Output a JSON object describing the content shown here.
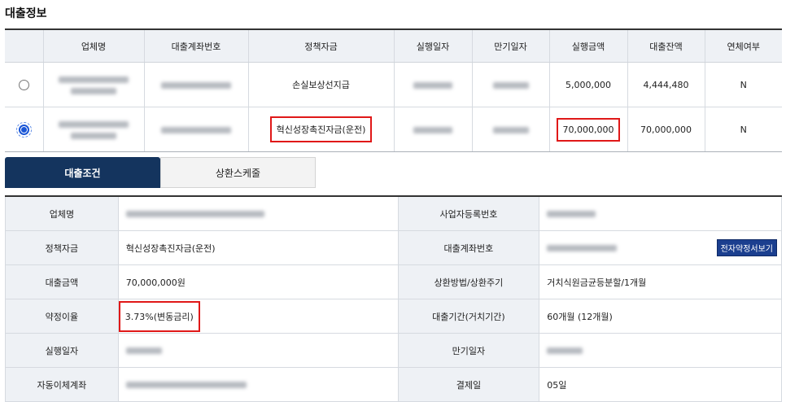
{
  "title": "대출정보",
  "loan_table": {
    "headers": [
      "업체명",
      "대출계좌번호",
      "정책자금",
      "실행일자",
      "만기일자",
      "실행금액",
      "대출잔액",
      "연체여부"
    ],
    "rows": [
      {
        "selected": false,
        "policy_fund": "손실보상선지급",
        "exec_amount": "5,000,000",
        "balance": "4,444,480",
        "overdue": "N"
      },
      {
        "selected": true,
        "policy_fund": "혁신성장촉진자금(운전)",
        "exec_amount": "70,000,000",
        "balance": "70,000,000",
        "overdue": "N"
      }
    ]
  },
  "tabs": {
    "active": "대출조건",
    "inactive": "상환스케줄"
  },
  "detail": {
    "company_label": "업체명",
    "biz_no_label": "사업자등록번호",
    "policy_label": "정책자금",
    "policy_value": "혁신성장촉진자금(운전)",
    "account_label": "대출계좌번호",
    "doc_button": "전자약정서보기",
    "amount_label": "대출금액",
    "amount_value": "70,000,000원",
    "repay_label": "상환방법/상환주기",
    "repay_value": "거치식원금균등분할/1개월",
    "rate_label": "약정이율",
    "rate_value": "3.73%(변동금리)",
    "period_label": "대출기간(거치기간)",
    "period_value": "60개월 (12개월)",
    "exec_date_label": "실행일자",
    "maturity_label": "만기일자",
    "autodebit_label": "자동이체계좌",
    "payday_label": "결제일",
    "payday_value": "05일"
  },
  "colors": {
    "accent": "#14345e",
    "highlight": "#e01818",
    "header_bg": "#eef1f5"
  }
}
